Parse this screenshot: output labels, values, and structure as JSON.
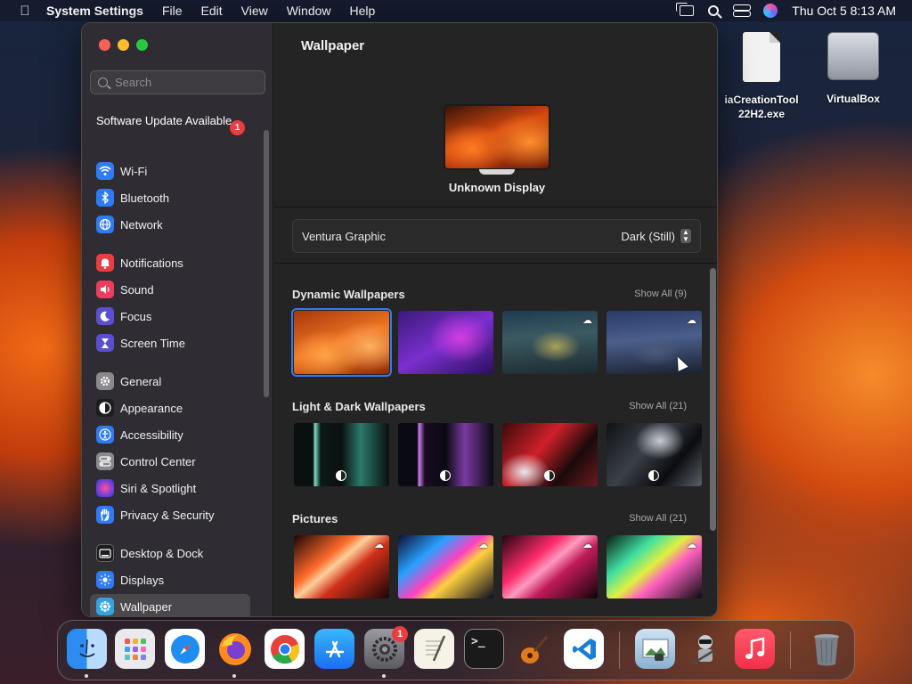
{
  "menubar": {
    "app_name": "System Settings",
    "menus": [
      "File",
      "Edit",
      "View",
      "Window",
      "Help"
    ],
    "clock": "Thu Oct 5  8:13 AM",
    "apple_icon": "apple-icon"
  },
  "desktop": {
    "icons": [
      {
        "label": "iaCreationTool\n22H2.exe",
        "icon": "document-icon"
      },
      {
        "label": "VirtualBox",
        "icon": "disk-icon"
      }
    ]
  },
  "sidebar": {
    "search_placeholder": "Search",
    "update": {
      "label": "Software Update Available",
      "badge": "1"
    },
    "groups": [
      [
        {
          "label": "Wi-Fi",
          "icon": "wifi-icon",
          "color": "#2f7bf5"
        },
        {
          "label": "Bluetooth",
          "icon": "bluetooth-icon",
          "color": "#2f7bf5"
        },
        {
          "label": "Network",
          "icon": "globe-icon",
          "color": "#2f7bf5"
        }
      ],
      [
        {
          "label": "Notifications",
          "icon": "bell-icon",
          "color": "#ea3d3f"
        },
        {
          "label": "Sound",
          "icon": "speaker-icon",
          "color": "#ea3d5f"
        },
        {
          "label": "Focus",
          "icon": "moon-icon",
          "color": "#5b4fd1"
        },
        {
          "label": "Screen Time",
          "icon": "hourglass-icon",
          "color": "#5b4fd1"
        }
      ],
      [
        {
          "label": "General",
          "icon": "gear-icon",
          "color": "#8a8a8e"
        },
        {
          "label": "Appearance",
          "icon": "appearance-icon",
          "color": "#1c1c1e"
        },
        {
          "label": "Accessibility",
          "icon": "accessibility-icon",
          "color": "#2f7bf5"
        },
        {
          "label": "Control Center",
          "icon": "toggles-icon",
          "color": "#8a8a8e"
        },
        {
          "label": "Siri & Spotlight",
          "icon": "siri-icon",
          "color": "#7a3fd1"
        },
        {
          "label": "Privacy & Security",
          "icon": "hand-icon",
          "color": "#2f7bf5"
        }
      ],
      [
        {
          "label": "Desktop & Dock",
          "icon": "dock-icon",
          "color": "#1c1c1e"
        },
        {
          "label": "Displays",
          "icon": "sun-icon",
          "color": "#2f7bf5"
        },
        {
          "label": "Wallpaper",
          "icon": "wallpaper-icon",
          "color": "#34a3e0",
          "active": true
        }
      ]
    ]
  },
  "main": {
    "title": "Wallpaper",
    "display_name": "Unknown Display",
    "wallpaper_name": "Ventura Graphic",
    "wallpaper_style": "Dark (Still)",
    "sections": [
      {
        "title": "Dynamic Wallpapers",
        "show_all": "Show All (9)"
      },
      {
        "title": "Light & Dark Wallpapers",
        "show_all": "Show All (21)"
      },
      {
        "title": "Pictures",
        "show_all": "Show All (21)"
      }
    ]
  },
  "dock": {
    "apps": [
      {
        "name": "Finder",
        "icon": "finder-icon"
      },
      {
        "name": "Launchpad",
        "icon": "launchpad-icon"
      },
      {
        "name": "Safari",
        "icon": "safari-icon"
      },
      {
        "name": "Firefox",
        "icon": "firefox-icon"
      },
      {
        "name": "Chrome",
        "icon": "chrome-icon"
      },
      {
        "name": "App Store",
        "icon": "appstore-icon"
      },
      {
        "name": "System Settings",
        "icon": "settings-icon",
        "badge": "1"
      },
      {
        "name": "TextEdit",
        "icon": "textedit-icon"
      },
      {
        "name": "Terminal",
        "icon": "terminal-icon"
      },
      {
        "name": "GarageBand",
        "icon": "guitar-icon"
      },
      {
        "name": "Visual Studio Code",
        "icon": "vscode-icon"
      },
      {
        "name": "Preview",
        "icon": "preview-icon"
      },
      {
        "name": "Automator",
        "icon": "automator-icon"
      },
      {
        "name": "Music",
        "icon": "music-icon"
      },
      {
        "name": "Trash",
        "icon": "trash-icon"
      }
    ]
  }
}
